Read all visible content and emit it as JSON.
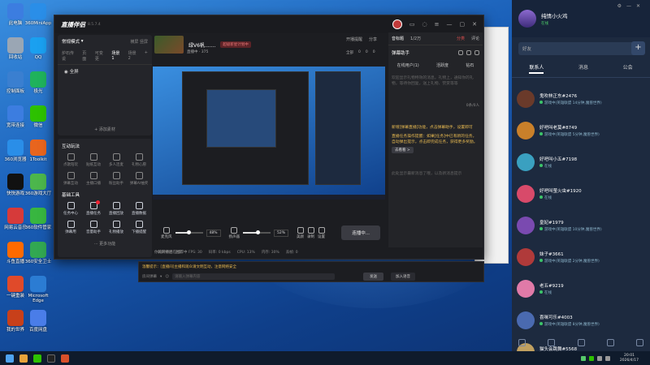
{
  "desktop_icons": [
    {
      "label": "此电脑",
      "color": "#3c7de0"
    },
    {
      "label": "360MiniApp",
      "color": "#2a8ee8"
    },
    {
      "label": "回收站",
      "color": "#9aa6b4"
    },
    {
      "label": "QQ",
      "color": "#1aa0f0"
    },
    {
      "label": "控制面板",
      "color": "#3a7fd0"
    },
    {
      "label": "极光",
      "color": "#1fb25c"
    },
    {
      "label": "宽带连接",
      "color": "#3c7de0"
    },
    {
      "label": "微信",
      "color": "#2dc100"
    },
    {
      "label": "360浏览器",
      "color": "#2a8ee8"
    },
    {
      "label": "1Toolkit",
      "color": "#e8651e"
    },
    {
      "label": "快快游戏",
      "color": "#111111"
    },
    {
      "label": "360游戏大厅",
      "color": "#4cb64c"
    },
    {
      "label": "网易云音乐",
      "color": "#d63a3a"
    },
    {
      "label": "360软件管家",
      "color": "#38b640"
    },
    {
      "label": "斗鱼直播",
      "color": "#ff6a00"
    },
    {
      "label": "360安全卫士",
      "color": "#32a852"
    },
    {
      "label": "一键重装",
      "color": "#e04a2a"
    },
    {
      "label": "Microsoft Edge",
      "color": "#2b7cd3"
    },
    {
      "label": "我的世界",
      "color": "#c8401a"
    },
    {
      "label": "百度网盘",
      "color": "#4a7de8"
    }
  ],
  "app": {
    "logo": "直播伴侣",
    "version": "8.5.7.4",
    "mode": "常规模式",
    "mode_right": "横屏 竖屏",
    "scenes": [
      "炉石传说",
      "页面",
      "可变更",
      "场景 1",
      "场景 2",
      "+"
    ],
    "source": "全屏",
    "add_source": "+ 添加素材",
    "interact_title": "互动玩法",
    "interact": [
      "点歌陪玩",
      "贴纸互动",
      "多人连麦",
      "礼物心愿",
      "弹幕互动",
      "主播口播",
      "粉丝助手",
      "弹幕AI抽奖"
    ],
    "tools_title": "基础工具",
    "tools": [
      "任务中心",
      "直播任务",
      "直播回放",
      "直播数据",
      "弹幕用",
      "音量助手",
      "礼物播放",
      "下播提醒"
    ],
    "more_fn": "··· 更多功能",
    "stream_name": "绿V6帆.......",
    "stream_tag": "超级新星计划中",
    "live_info": "直播中 · 375",
    "top_right": [
      "开播提醒",
      "分享"
    ],
    "top_right2": [
      "全部",
      "0",
      "0",
      "0"
    ],
    "mic_label": "麦克风",
    "mic_pct": "48%",
    "mic_level": 0.48,
    "spk_label": "扬声器",
    "spk_pct": "52%",
    "spk_level": 0.52,
    "ctrl": [
      "美颜",
      "录制",
      "设置"
    ],
    "start_btn": "连播中...",
    "stats": [
      "弱网评估: 正常",
      "FPS: 30",
      "码率: 0 kbps",
      "CPU: 13%",
      "内存: 30%",
      "丢帧: 0"
    ],
    "stat_live": "当前游戏战斗模式开播中",
    "right_tabs": [
      "音标题",
      "1/2万",
      "分类",
      "评论"
    ],
    "danmu_title": "弹幕助手",
    "danmu_sub": [
      "在线用户(1)",
      "活跃度",
      "钻石"
    ],
    "danmu_msg1": "欢迎显示礼物特效的消息，礼物上，通知你的礼物，等待你回复，送上礼物、赞赏等等",
    "danmu_count": "0条/0人",
    "danmu_msg2": "新增[弹幕直播]功能，点击弹幕助手，设置即可",
    "danmu_msg3": "直播任务操作提醒：如果[任务]中已有新的任务，自动弹出提示，点击即完成任务，获得更多奖励。",
    "more_btn": "去看看 >",
    "danmu_msg4": "此处显示最新消息了哦，以及新消息提示",
    "mini_note": "你的开播还在推荐中"
  },
  "chat": {
    "notice": "温馨提示：[直播间]主播和观众请文明互动，注意网络安全",
    "select": "房间弹幕",
    "placeholder": "请输入弹幕内容",
    "send": "发送",
    "join": "加入语音"
  },
  "friends": {
    "user": "纯情小火鸡",
    "user_status": "在线",
    "search": "好友",
    "tabs": [
      "联系人",
      "消息",
      "公会"
    ],
    "list": [
      {
        "name": "鬼吹林正东#2476",
        "status": "游戏中(英雄联盟 14分钟,魔兽世界)",
        "color": "#6a3a2a"
      },
      {
        "name": "好吧叫老莫#8749",
        "status": "游戏中(英雄联盟 5分钟,魔兽世界)",
        "color": "#c9802a"
      },
      {
        "name": "好吧叫小五#7198",
        "status": "在线",
        "color": "#3aa0c0"
      },
      {
        "name": "好吧叫萤火虫#1920",
        "status": "在线",
        "color": "#d84a6a"
      },
      {
        "name": "皇妃#1979",
        "status": "游戏中(英雄联盟 10分钟,魔兽世界)",
        "color": "#7a4ab0"
      },
      {
        "name": "妹子#3661",
        "status": "游戏中(英雄联盟 2分钟,魔兽世界)",
        "color": "#b03a3a"
      },
      {
        "name": "老五#9219",
        "status": "在线",
        "color": "#e07aa8"
      },
      {
        "name": "喜咪可乐#4003",
        "status": "游戏中(英雄联盟 8分钟,魔兽世界)",
        "color": "#4a6ab0"
      },
      {
        "name": "猫头会跳舞#5568",
        "status": "在线",
        "color": "#c0a060"
      }
    ]
  },
  "taskbar": {
    "time": "20:01",
    "date": "2026/4/17"
  }
}
